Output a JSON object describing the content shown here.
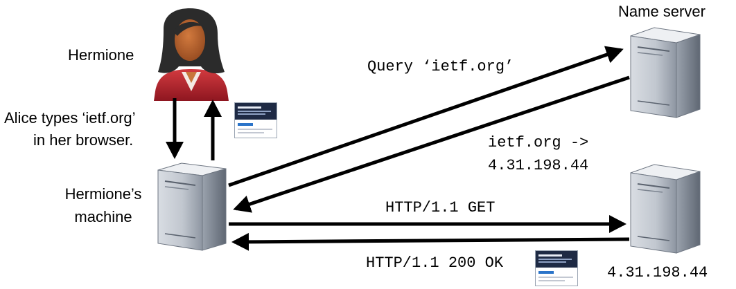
{
  "labels": {
    "hermione": "Hermione",
    "alice_types_1": "Alice types ‘ietf.org’",
    "alice_types_2": "in her browser.",
    "hermione_machine_1": "Hermione’s",
    "hermione_machine_2": "machine",
    "name_server": "Name server",
    "query": "Query ‘ietf.org’",
    "dns_answer_1": "ietf.org ->",
    "dns_answer_2": "4.31.198.44",
    "http_get": "HTTP/1.1 GET",
    "http_ok": "HTTP/1.1 200 OK",
    "web_server_ip": "4.31.198.44"
  },
  "colors": {
    "arrow": "#000000",
    "server_light": "#e6e9ee",
    "server_mid": "#a9b0bb",
    "server_dark": "#6e7682",
    "person_hair": "#2a2a2a",
    "person_skin": "#b8652f",
    "person_jacket": "#b3202a"
  },
  "icons": {
    "person": "person-icon",
    "server": "server-icon",
    "webpage": "webpage-thumbnail-icon"
  }
}
